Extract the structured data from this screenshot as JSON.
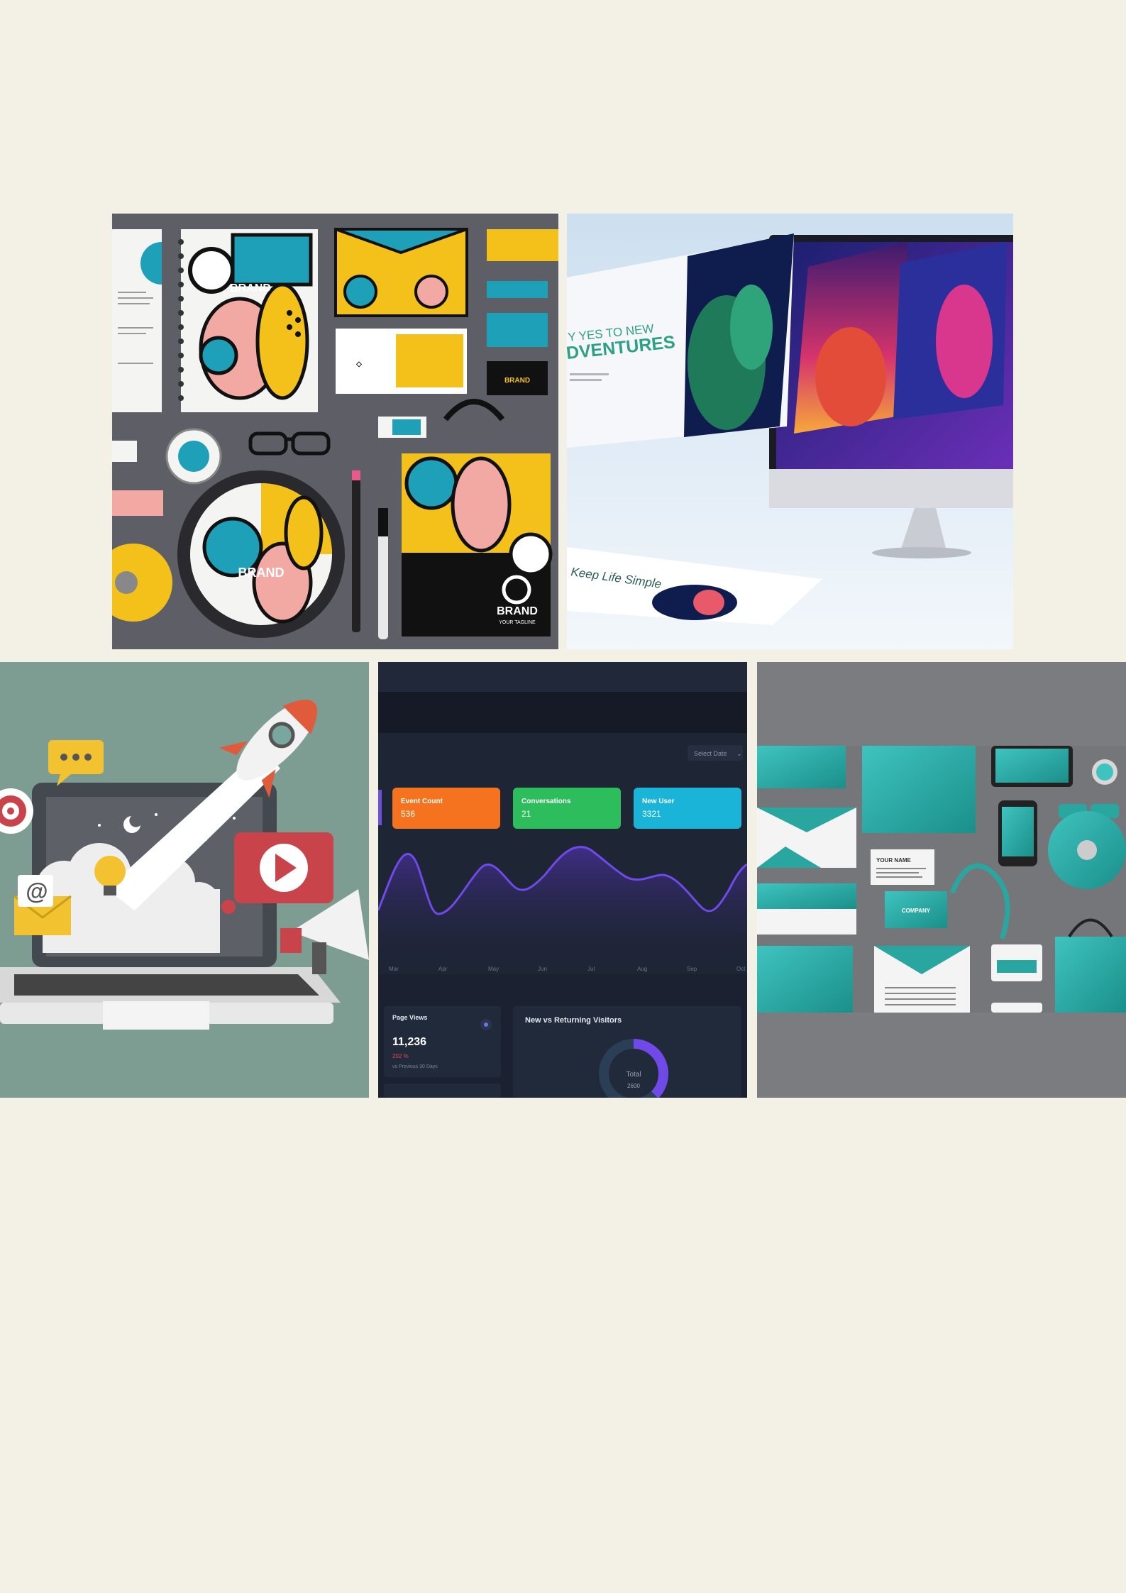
{
  "gallery": {
    "background": "#f3f0e6",
    "tiles": [
      {
        "name": "branding-stationery-mockup",
        "brand_text": "BRAND",
        "tagline": "YOUR TAGLINE"
      },
      {
        "name": "website-screens-on-monitor",
        "headline_line1": "Y YES TO NEW",
        "headline_line2": "DVENTURES",
        "card_text": "Keep Life Simple"
      },
      {
        "name": "digital-marketing-laptop-illustration",
        "at_symbol": "@"
      },
      {
        "name": "analytics-dashboard",
        "select_label": "Select Date",
        "cards": [
          {
            "label": "Event Count",
            "value": "536",
            "color": "#f5731f"
          },
          {
            "label": "Conversations",
            "value": "21",
            "color": "#2ebd5c"
          },
          {
            "label": "New User",
            "value": "3321",
            "color": "#1ab4d9"
          }
        ],
        "months": [
          "Mar",
          "Apr",
          "May",
          "Jun",
          "Jul",
          "Aug",
          "Sep",
          "Oct"
        ],
        "page_views": {
          "label": "Page Views",
          "value": "11,236",
          "change": "202 %",
          "compare": "vs Previous 30 Days"
        },
        "visitors": {
          "title": "New vs Returning Visitors",
          "total_label": "Total",
          "total_value": "2600"
        }
      },
      {
        "name": "corporate-identity-teal-mockup",
        "your_name": "YOUR NAME",
        "company_text": "COMPANY"
      }
    ]
  }
}
